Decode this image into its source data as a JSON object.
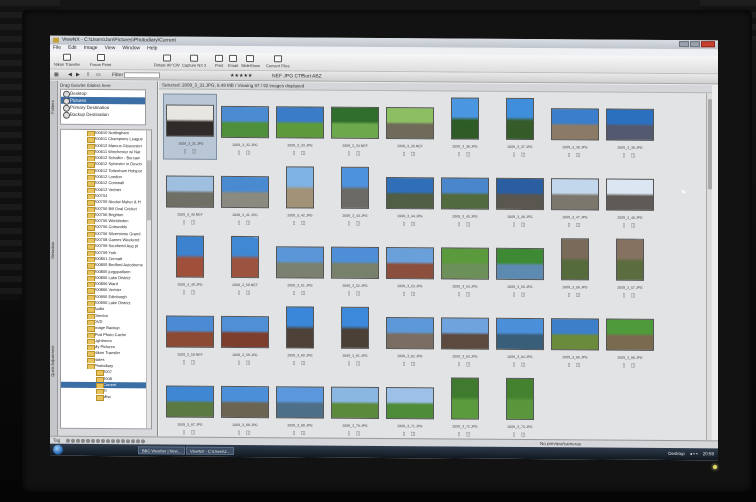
{
  "window": {
    "title": "ViewNX - C:\\Users\\Jon\\Pictures\\Photodiary\\Current"
  },
  "menu": [
    "File",
    "Edit",
    "Image",
    "View",
    "Window",
    "Help"
  ],
  "toolbar": {
    "buttons": [
      {
        "label": "Nikon Transfer",
        "icon": "transfer-icon"
      },
      {
        "label": "Focus Point",
        "icon": "focus-point-icon"
      },
      {
        "label": "Rotate 90°CW",
        "icon": "rotate-icon"
      },
      {
        "label": "Capture NX 2",
        "icon": "capture-nx-icon"
      },
      {
        "label": "Print",
        "icon": "print-icon"
      },
      {
        "label": "Email",
        "icon": "email-icon"
      },
      {
        "label": "SlideShow",
        "icon": "slideshow-icon"
      },
      {
        "label": "Convert Files",
        "icon": "convert-icon"
      }
    ]
  },
  "toolbar2": {
    "filter_label": "Filter",
    "rating": "★★★★★",
    "formats": "NEF JPG CTF",
    "sort_label": "Sort",
    "sort_value": "ABZ"
  },
  "sidebar": {
    "tabs": [
      "Folders",
      "Metadata",
      "Quick Adjustment"
    ],
    "favorites_header": "Drag favorite folders here",
    "favorites": [
      "Desktop",
      "Pictures",
      "Primary Destination",
      "Backup Destination"
    ],
    "favorites_selected": 1,
    "tree": [
      "200610 Nottingham",
      "200611 Champions League",
      "200612 Marcus Gloucester",
      "200611 Winchester wi Nat",
      "200612 Schaller - Bercaw",
      "200612 Sylvester in Devon",
      "200612 Tottenham Hotspur",
      "200612 London",
      "200612 Cornwall",
      "200612 Verbier",
      "200704",
      "200705 Nicolai Maher & H",
      "200706 Bill Oval Cricket",
      "200706 Brighton",
      "200706 Wimbledon",
      "200706 Cotswolds",
      "200706 Silverstone Grand",
      "200708 Games Weekend",
      "200709 Southend Aug pt",
      "200709 York",
      "200801 Zermatt",
      "200805 Bedford Autodrome",
      "200805 jurgypaifarm",
      "200806 Lake District",
      "200806 Ward",
      "200806 Verbier",
      "200906 Edinburgh",
      "200906 Lake District",
      "Audio",
      "Director",
      "DVD",
      "Image Backup",
      "iPod Photo Cache",
      "Lightroom",
      "My Pictures",
      "Nikon Transfer",
      "Notes",
      "Photodiary",
      "2007",
      "2008",
      "Current",
      "ZI",
      "Misc"
    ],
    "tree_selected": 40
  },
  "content": {
    "header": "Selected: 2009_3_31.JPG, 8.49 MB / Viewing 87 / 92 images displayed",
    "thumbnails": [
      {
        "name": "2009_3_31.JPG",
        "orient": "land",
        "c1": "#e8e6e0",
        "c2": "#302a28",
        "sel": true
      },
      {
        "name": "2009_3_32.JPG",
        "orient": "land",
        "c1": "#4a8bd1",
        "c2": "#4d8f3a"
      },
      {
        "name": "2009_3_33.JPG",
        "orient": "land",
        "c1": "#3b7cc9",
        "c2": "#5c9a3c"
      },
      {
        "name": "2009_3_34.NEF",
        "orient": "land",
        "c1": "#2f6e2c",
        "c2": "#6ba94c"
      },
      {
        "name": "2009_3_35.NEF",
        "orient": "land",
        "c1": "#8cbf62",
        "c2": "#6f6a59"
      },
      {
        "name": "2009_3_36.JPG",
        "orient": "port",
        "c1": "#4a96e0",
        "c2": "#2f5b26"
      },
      {
        "name": "2009_3_37.JPG",
        "orient": "port",
        "c1": "#3f8edb",
        "c2": "#355b28"
      },
      {
        "name": "2009_3_38.JPG",
        "orient": "land",
        "c1": "#3b7fcc",
        "c2": "#8b7a66"
      },
      {
        "name": "2009_3_39.JPG",
        "orient": "land",
        "c1": "#2b6fbf",
        "c2": "#535a70"
      },
      {
        "name": "2009_3_40.NEF",
        "orient": "land",
        "c1": "#9fbfe0",
        "c2": "#6f6f66"
      },
      {
        "name": "2009_3_41.JPG",
        "orient": "land",
        "c1": "#4a8ad1",
        "c2": "#8a8a80"
      },
      {
        "name": "2009_3_42.JPG",
        "orient": "port",
        "c1": "#7fb3e6",
        "c2": "#a29378"
      },
      {
        "name": "2009_3_43.JPG",
        "orient": "port",
        "c1": "#4d92dc",
        "c2": "#6b6a64"
      },
      {
        "name": "2009_3_44.JPG",
        "orient": "land",
        "c1": "#2e6fb8",
        "c2": "#4f5e44"
      },
      {
        "name": "2009_3_45.JPG",
        "orient": "land",
        "c1": "#4986cc",
        "c2": "#516b3f"
      },
      {
        "name": "2009_3_46.JPG",
        "orient": "land",
        "c1": "#2b5ea0",
        "c2": "#5a5650"
      },
      {
        "name": "2009_3_47.JPG",
        "orient": "land",
        "c1": "#c2d7ec",
        "c2": "#7b776c"
      },
      {
        "name": "2009_3_48.JPG",
        "orient": "land",
        "c1": "#dbe6f2",
        "c2": "#5f5a55"
      },
      {
        "name": "2009_3_49.JPG",
        "orient": "port",
        "c1": "#3c82cf",
        "c2": "#a0503a"
      },
      {
        "name": "2009_3_50.NEF",
        "orient": "port",
        "c1": "#3f88d4",
        "c2": "#9c5440"
      },
      {
        "name": "2009_3_51.JPG",
        "orient": "land",
        "c1": "#5b97d8",
        "c2": "#7a8170"
      },
      {
        "name": "2009_3_52.JPG",
        "orient": "land",
        "c1": "#4e8ed6",
        "c2": "#77806a"
      },
      {
        "name": "2009_3_53.JPG",
        "orient": "land",
        "c1": "#6aa0da",
        "c2": "#8c4f3d"
      },
      {
        "name": "2009_3_54.JPG",
        "orient": "land",
        "c1": "#5b9a3c",
        "c2": "#6d8f5a"
      },
      {
        "name": "2009_3_55.JPG",
        "orient": "land",
        "c1": "#3e8a34",
        "c2": "#5d8ab0"
      },
      {
        "name": "2009_3_56.JPG",
        "orient": "port",
        "c1": "#7a6a5a",
        "c2": "#556b3c"
      },
      {
        "name": "2009_3_57.JPG",
        "orient": "port",
        "c1": "#857261",
        "c2": "#5b6d3e"
      },
      {
        "name": "2009_3_58.NEF",
        "orient": "land",
        "c1": "#4b8bd3",
        "c2": "#8c4a35"
      },
      {
        "name": "2009_3_59.JPG",
        "orient": "land",
        "c1": "#4e8fd6",
        "c2": "#7e3e2e"
      },
      {
        "name": "2009_3_60.JPG",
        "orient": "port",
        "c1": "#3a86d8",
        "c2": "#4e4238"
      },
      {
        "name": "2009_3_61.JPG",
        "orient": "port",
        "c1": "#3c88da",
        "c2": "#4b4036"
      },
      {
        "name": "2009_3_62.JPG",
        "orient": "land",
        "c1": "#5c98d8",
        "c2": "#7a6e62"
      },
      {
        "name": "2009_3_63.JPG",
        "orient": "land",
        "c1": "#6fa3de",
        "c2": "#5c4a3e"
      },
      {
        "name": "2009_3_64.JPG",
        "orient": "land",
        "c1": "#4a8fd8",
        "c2": "#395e7a"
      },
      {
        "name": "2009_3_65.JPG",
        "orient": "land",
        "c1": "#3d7fc8",
        "c2": "#6a8a3c"
      },
      {
        "name": "2009_3_66.JPG",
        "orient": "land",
        "c1": "#4f9a3a",
        "c2": "#7a6a50"
      },
      {
        "name": "2009_3_67.JPG",
        "orient": "land",
        "c1": "#3f86d3",
        "c2": "#5b7a42"
      },
      {
        "name": "2009_3_68.JPG",
        "orient": "land",
        "c1": "#4b8fd8",
        "c2": "#6c6452"
      },
      {
        "name": "2009_3_69.JPG",
        "orient": "land",
        "c1": "#5b97dc",
        "c2": "#4e6f88"
      },
      {
        "name": "2009_3_70.JPG",
        "orient": "land",
        "c1": "#8ab6e2",
        "c2": "#5b8a3c"
      },
      {
        "name": "2009_3_71.JPG",
        "orient": "land",
        "c1": "#9cc0e8",
        "c2": "#4f8c3a"
      },
      {
        "name": "2009_3_72.JPG",
        "orient": "port",
        "c1": "#3f7a2e",
        "c2": "#5c9a3e"
      },
      {
        "name": "2009_3_73.JPG",
        "orient": "port",
        "c1": "#44822f",
        "c2": "#5a963b"
      }
    ]
  },
  "statusbar": {
    "tag_label": "Tag",
    "preview_label": "No preview/cameras"
  },
  "taskbar": {
    "items": [
      "BBC Weather | New...",
      "ViewNX - C:\\Users\\J..."
    ],
    "desktop_label": "Desktop",
    "clock": "20:59"
  }
}
